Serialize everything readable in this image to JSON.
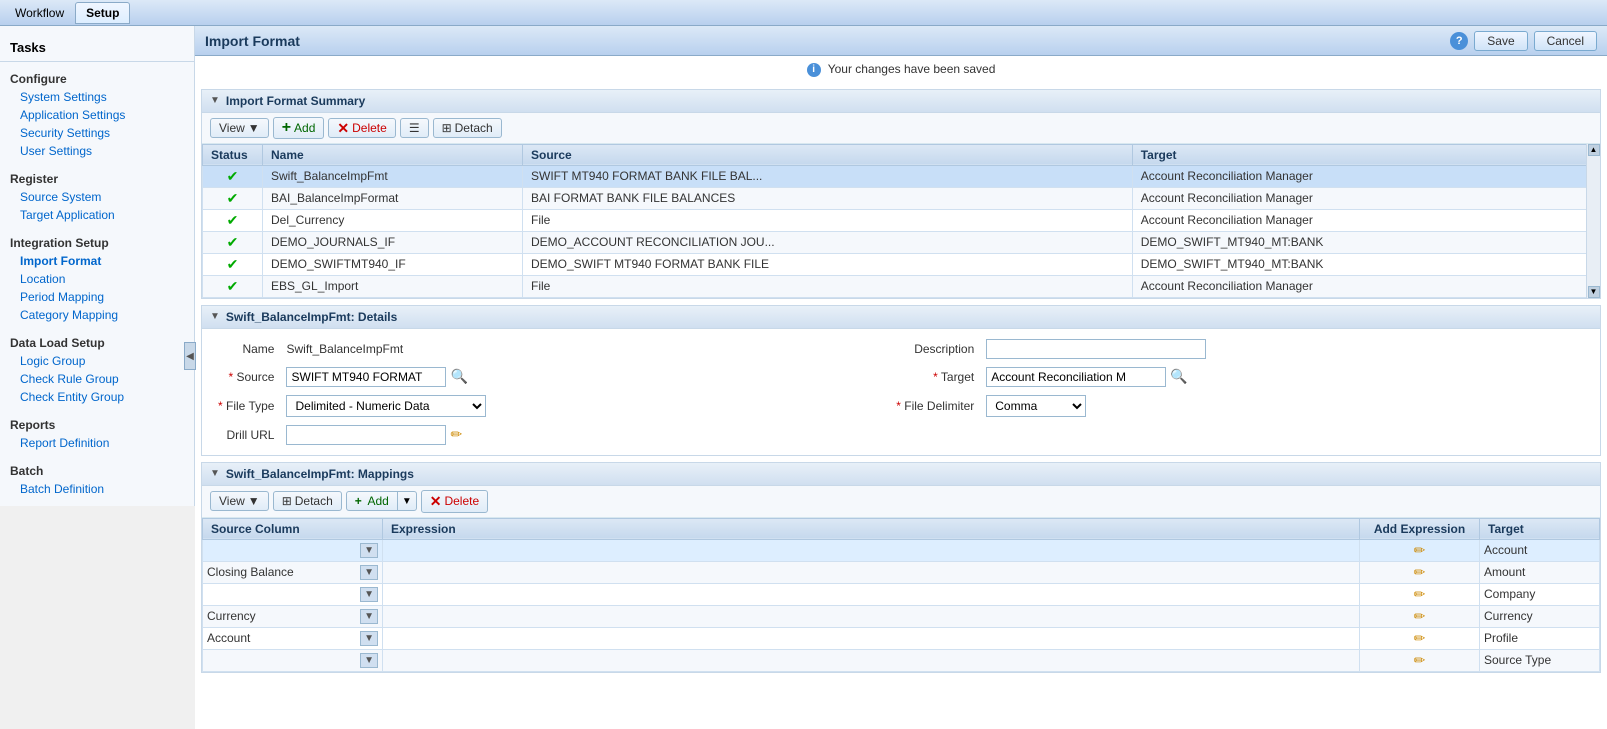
{
  "menu": {
    "tabs": [
      {
        "label": "Workflow",
        "active": false
      },
      {
        "label": "Setup",
        "active": true
      }
    ]
  },
  "tasks_panel": {
    "title": "Tasks"
  },
  "sidebar": {
    "sections": [
      {
        "title": "Configure",
        "links": [
          {
            "label": "System Settings",
            "active": false
          },
          {
            "label": "Application Settings",
            "active": false
          },
          {
            "label": "Security Settings",
            "active": false
          },
          {
            "label": "User Settings",
            "active": false
          }
        ]
      },
      {
        "title": "Register",
        "links": [
          {
            "label": "Source System",
            "active": false
          },
          {
            "label": "Target Application",
            "active": false
          }
        ]
      },
      {
        "title": "Integration Setup",
        "links": [
          {
            "label": "Import Format",
            "active": true
          },
          {
            "label": "Location",
            "active": false
          },
          {
            "label": "Period Mapping",
            "active": false
          },
          {
            "label": "Category Mapping",
            "active": false
          }
        ]
      },
      {
        "title": "Data Load Setup",
        "links": [
          {
            "label": "Logic Group",
            "active": false
          },
          {
            "label": "Check Rule Group",
            "active": false
          },
          {
            "label": "Check Entity Group",
            "active": false
          }
        ]
      },
      {
        "title": "Reports",
        "links": [
          {
            "label": "Report Definition",
            "active": false
          }
        ]
      },
      {
        "title": "Batch",
        "links": [
          {
            "label": "Batch Definition",
            "active": false
          }
        ]
      }
    ]
  },
  "content": {
    "title": "Import Format",
    "save_label": "Save",
    "cancel_label": "Cancel",
    "saved_message": "Your changes have been saved",
    "summary_section": {
      "title": "Import Format Summary",
      "toolbar": {
        "view_label": "View",
        "add_label": "Add",
        "delete_label": "Delete",
        "detach_label": "Detach"
      },
      "table": {
        "columns": [
          "Status",
          "Name",
          "Source",
          "Target"
        ],
        "rows": [
          {
            "status": "✔",
            "name": "Swift_BalanceImpFmt",
            "source": "SWIFT MT940 FORMAT BANK FILE BAL...",
            "target": "Account Reconciliation Manager",
            "selected": true
          },
          {
            "status": "✔",
            "name": "BAI_BalanceImpFormat",
            "source": "BAI FORMAT BANK FILE BALANCES",
            "target": "Account Reconciliation Manager",
            "selected": false
          },
          {
            "status": "✔",
            "name": "Del_Currency",
            "source": "File",
            "target": "Account Reconciliation Manager",
            "selected": false
          },
          {
            "status": "✔",
            "name": "DEMO_JOURNALS_IF",
            "source": "DEMO_ACCOUNT RECONCILIATION JOU...",
            "target": "DEMO_SWIFT_MT940_MT:BANK",
            "selected": false
          },
          {
            "status": "✔",
            "name": "DEMO_SWIFTMT940_IF",
            "source": "DEMO_SWIFT MT940 FORMAT BANK FILE",
            "target": "DEMO_SWIFT_MT940_MT:BANK",
            "selected": false
          },
          {
            "status": "✔",
            "name": "EBS_GL_Import",
            "source": "File",
            "target": "Account Reconciliation Manager",
            "selected": false
          }
        ]
      }
    },
    "details_section": {
      "title": "Swift_BalanceImpFmt: Details",
      "fields": {
        "name_label": "Name",
        "name_value": "Swift_BalanceImpFmt",
        "description_label": "Description",
        "description_value": "",
        "source_label": "Source",
        "source_value": "SWIFT MT940 FORMAT",
        "target_label": "Target",
        "target_value": "Account Reconciliation M",
        "file_type_label": "File Type",
        "file_type_value": "Delimited - Numeric Data",
        "file_delimiter_label": "File Delimiter",
        "file_delimiter_value": "Comma",
        "drill_url_label": "Drill URL",
        "drill_url_value": ""
      }
    },
    "mappings_section": {
      "title": "Swift_BalanceImpFmt: Mappings",
      "toolbar": {
        "view_label": "View",
        "add_label": "Add",
        "delete_label": "Delete",
        "detach_label": "Detach"
      },
      "table": {
        "columns": [
          "Source Column",
          "Expression",
          "Add Expression",
          "Target"
        ],
        "rows": [
          {
            "source": "",
            "expression": "",
            "add_expr": "✏",
            "target": "Account",
            "highlight": true
          },
          {
            "source": "Closing Balance",
            "expression": "",
            "add_expr": "✏",
            "target": "Amount",
            "highlight": false
          },
          {
            "source": "",
            "expression": "",
            "add_expr": "✏",
            "target": "Company",
            "highlight": false
          },
          {
            "source": "Currency",
            "expression": "",
            "add_expr": "✏",
            "target": "Currency",
            "highlight": false
          },
          {
            "source": "Account",
            "expression": "",
            "add_expr": "✏",
            "target": "Profile",
            "highlight": false
          },
          {
            "source": "",
            "expression": "",
            "add_expr": "✏",
            "target": "Source Type",
            "highlight": false
          }
        ]
      }
    }
  }
}
